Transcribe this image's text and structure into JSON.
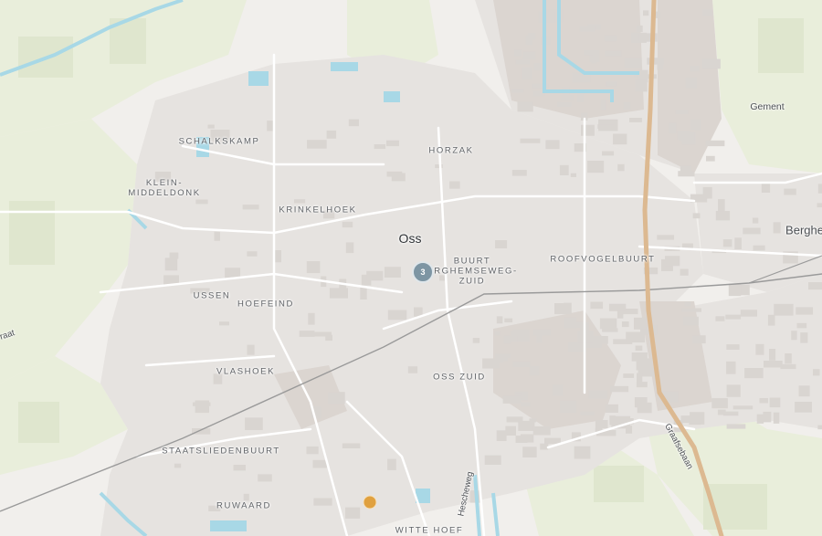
{
  "map": {
    "city": "Oss",
    "districts": {
      "schalkskamp": "SCHALKSKAMP",
      "klein_middeldonk": "KLEIN-\nMIDDELDONK",
      "krinkelhoek": "KRINKELHOEK",
      "horzak": "HORZAK",
      "buurt_erghemseweg_zuid": "BUURT\nERGHEMSEWEG-\nZUID",
      "roofvogelbuurt": "ROOFVOGELBUURT",
      "ussen": "USSEN",
      "hoefeind": "HOEFEIND",
      "vlashoek": "VLASHOEK",
      "oss_zuid": "OSS ZUID",
      "staatsliedenbuurt": "STAATSLIEDENBUURT",
      "ruwaard": "RUWAARD",
      "witte_hoef": "WITTE HOEF"
    },
    "villages": {
      "gement": "Gement",
      "berghem": "Berghe"
    },
    "roads": {
      "graafsebaan": "Graafsebaan",
      "hescheweg": "Hescheweg",
      "west_road": "raat"
    },
    "markers": {
      "cluster_count": "3",
      "poi_color": "#e0a140",
      "cluster_color": "#7d95a3"
    },
    "colors": {
      "land": "#f1efec",
      "urban": "#e6e3e0",
      "industrial": "#dbd5d0",
      "fields": "#e9eedb",
      "water": "#a8d8e6",
      "highway": "#dcb991",
      "rail": "#8a8a8a"
    }
  }
}
